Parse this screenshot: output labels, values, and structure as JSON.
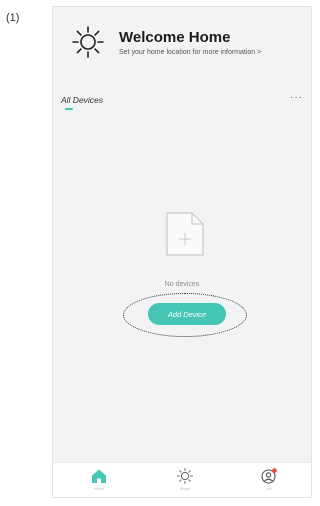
{
  "step_label": "(1)",
  "header": {
    "title": "Welcome Home",
    "subtitle": "Set your home location for more information >",
    "icon": "sun-icon"
  },
  "tabs": {
    "all_devices": "All Devices",
    "more_icon": "more-horizontal-icon",
    "more_text": "···"
  },
  "empty_state": {
    "message": "No devices",
    "icon": "empty-document-icon",
    "add_button": "Add Device"
  },
  "bottom_nav": {
    "items": [
      {
        "label": "Home",
        "icon": "home-icon",
        "active": true
      },
      {
        "label": "Smart",
        "icon": "smart-sun-icon",
        "active": false
      },
      {
        "label": "Me",
        "icon": "profile-icon",
        "active": false
      }
    ]
  },
  "colors": {
    "accent": "#46c6b5",
    "background": "#f2f3f5",
    "notification_dot": "#e8453c"
  }
}
